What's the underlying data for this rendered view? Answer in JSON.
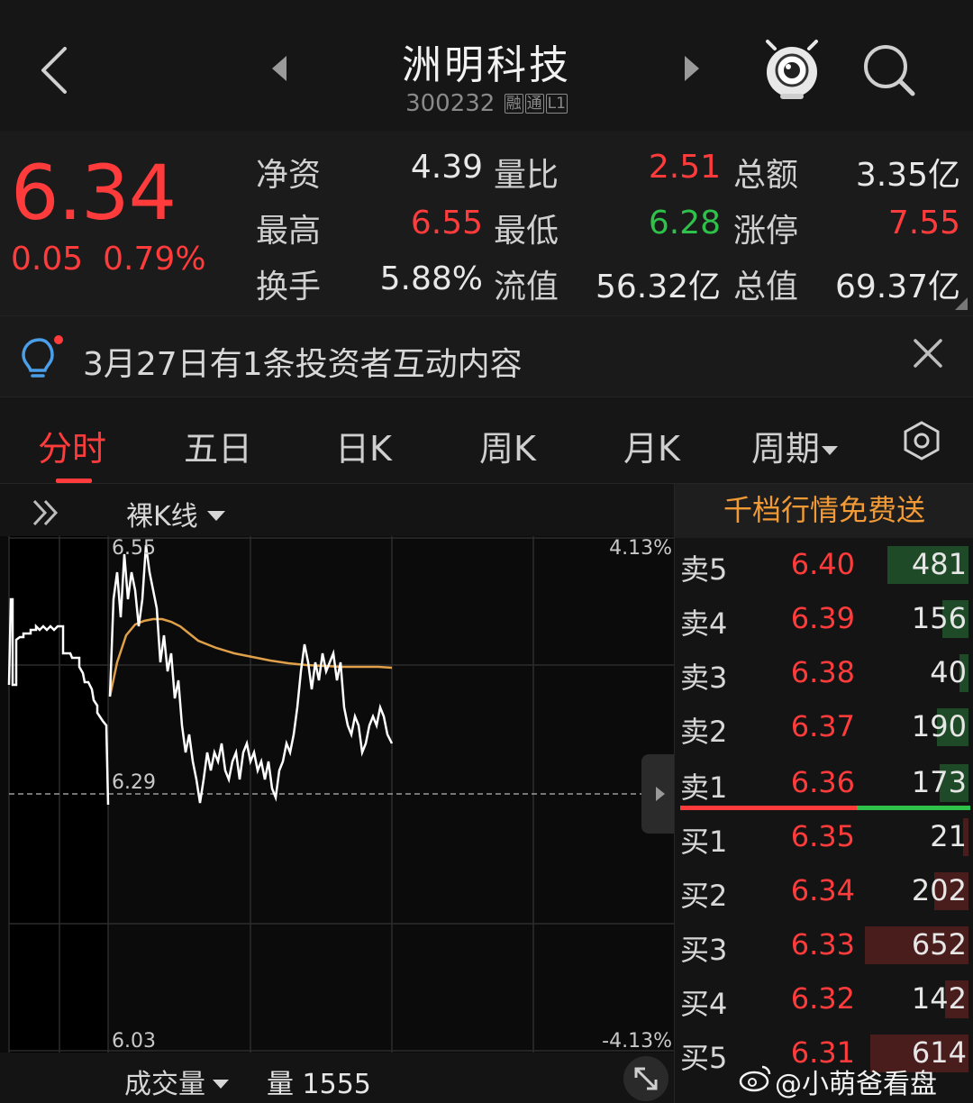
{
  "header": {
    "title": "洲明科技",
    "code": "300232",
    "tags": [
      "融",
      "通",
      "L1"
    ]
  },
  "quote": {
    "price": "6.34",
    "change": "0.05",
    "change_pct": "0.79%",
    "stats": [
      [
        {
          "label": "净资",
          "value": "4.39",
          "color": "#e8e8e8"
        },
        {
          "label": "量比",
          "value": "2.51",
          "color": "#ff3b3b"
        },
        {
          "label": "总额",
          "value": "3.35亿",
          "color": "#e8e8e8"
        }
      ],
      [
        {
          "label": "最高",
          "value": "6.55",
          "color": "#ff3b3b"
        },
        {
          "label": "最低",
          "value": "6.28",
          "color": "#2ec24a"
        },
        {
          "label": "涨停",
          "value": "7.55",
          "color": "#ff3b3b"
        }
      ],
      [
        {
          "label": "换手",
          "value": "5.88%",
          "color": "#e8e8e8"
        },
        {
          "label": "流值",
          "value": "56.32亿",
          "color": "#e8e8e8"
        },
        {
          "label": "总值",
          "value": "69.37亿",
          "color": "#e8e8e8"
        }
      ]
    ]
  },
  "notice": {
    "text": "3月27日有1条投资者互动内容"
  },
  "tabs": {
    "items": [
      "分时",
      "五日",
      "日K",
      "周K",
      "月K",
      "周期"
    ],
    "active": 0
  },
  "chart": {
    "mode_label": "裸K线",
    "axis": {
      "top_price": "6.55",
      "mid_price": "6.29",
      "bottom_price": "6.03",
      "top_pct": "4.13%",
      "bottom_pct": "-4.13%"
    },
    "volume_label": "成交量",
    "volume_prefix": "量",
    "volume_value": "1555"
  },
  "order_book": {
    "title": "千档行情免费送",
    "asks": [
      {
        "label": "卖5",
        "price": "6.40",
        "volume": "481",
        "bar": 0.28,
        "bar_color": "#1f4a27"
      },
      {
        "label": "卖4",
        "price": "6.39",
        "volume": "156",
        "bar": 0.09,
        "bar_color": "#1f4a27"
      },
      {
        "label": "卖3",
        "price": "6.38",
        "volume": "40",
        "bar": 0.03,
        "bar_color": "#1f4a27"
      },
      {
        "label": "卖2",
        "price": "6.37",
        "volume": "190",
        "bar": 0.11,
        "bar_color": "#1f4a27"
      },
      {
        "label": "卖1",
        "price": "6.36",
        "volume": "173",
        "bar": 0.1,
        "bar_color": "#1f4a27"
      }
    ],
    "bids": [
      {
        "label": "买1",
        "price": "6.35",
        "volume": "21",
        "bar": 0.02,
        "bar_color": "#4a1d1d"
      },
      {
        "label": "买2",
        "price": "6.34",
        "volume": "202",
        "bar": 0.12,
        "bar_color": "#4a1d1d"
      },
      {
        "label": "买3",
        "price": "6.33",
        "volume": "652",
        "bar": 0.36,
        "bar_color": "#4a1d1d"
      },
      {
        "label": "买4",
        "price": "6.32",
        "volume": "142",
        "bar": 0.08,
        "bar_color": "#4a1d1d"
      },
      {
        "label": "买5",
        "price": "6.31",
        "volume": "614",
        "bar": 0.34,
        "bar_color": "#4a1d1d"
      }
    ]
  },
  "watermark": "@小萌爸看盘",
  "colors": {
    "up": "#ff3b3b",
    "down": "#2ec24a",
    "avg_line": "#e0a04a",
    "accent": "#f29a36"
  }
}
